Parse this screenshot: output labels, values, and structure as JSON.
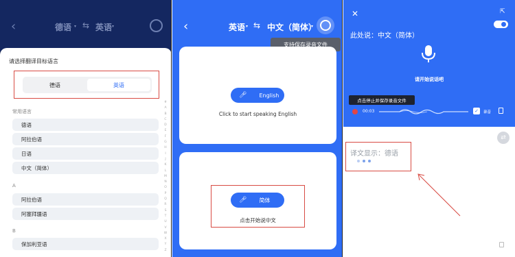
{
  "panel1": {
    "source_lang": "德语",
    "target_lang": "英语",
    "swap_icon": "⇆",
    "sheet_title": "请选择翻译目标语言",
    "segment": {
      "left": "德语",
      "right": "英语"
    },
    "common_label": "常用语言",
    "common_items": [
      "德语",
      "阿拉伯语",
      "日语",
      "中文（简体）"
    ],
    "section_a": "A",
    "a_items": [
      "阿拉伯语",
      "阿塞拜疆语"
    ],
    "section_b": "B",
    "b_items": [
      "保加利亚语"
    ],
    "index_letters": [
      "#",
      "A",
      "B",
      "C",
      "D",
      "E",
      "F",
      "G",
      "H",
      "I",
      "J",
      "K",
      "L",
      "M",
      "N",
      "O",
      "P",
      "Q",
      "R",
      "S",
      "T",
      "U",
      "V",
      "W",
      "X",
      "Y",
      "Z"
    ]
  },
  "panel2": {
    "source_lang": "英语",
    "target_lang": "中文（简体）",
    "swap_icon": "⇆",
    "tooltip": "支持保存录音文件",
    "english_btn": "English",
    "english_caption": "Click to start speaking English",
    "chinese_btn": "简体",
    "chinese_caption": "点击开始说中文"
  },
  "panel3": {
    "source_text": "此处说：中文（简体）",
    "start_text": "请开始说话吧",
    "tip": "点击停止并保存录音文件",
    "time": "00:03",
    "save_label": "录音",
    "target_text": "译文显示：德语"
  },
  "colors": {
    "accent": "#2f6df5",
    "highlight": "#d84a42",
    "dark_nav": "#142760"
  }
}
